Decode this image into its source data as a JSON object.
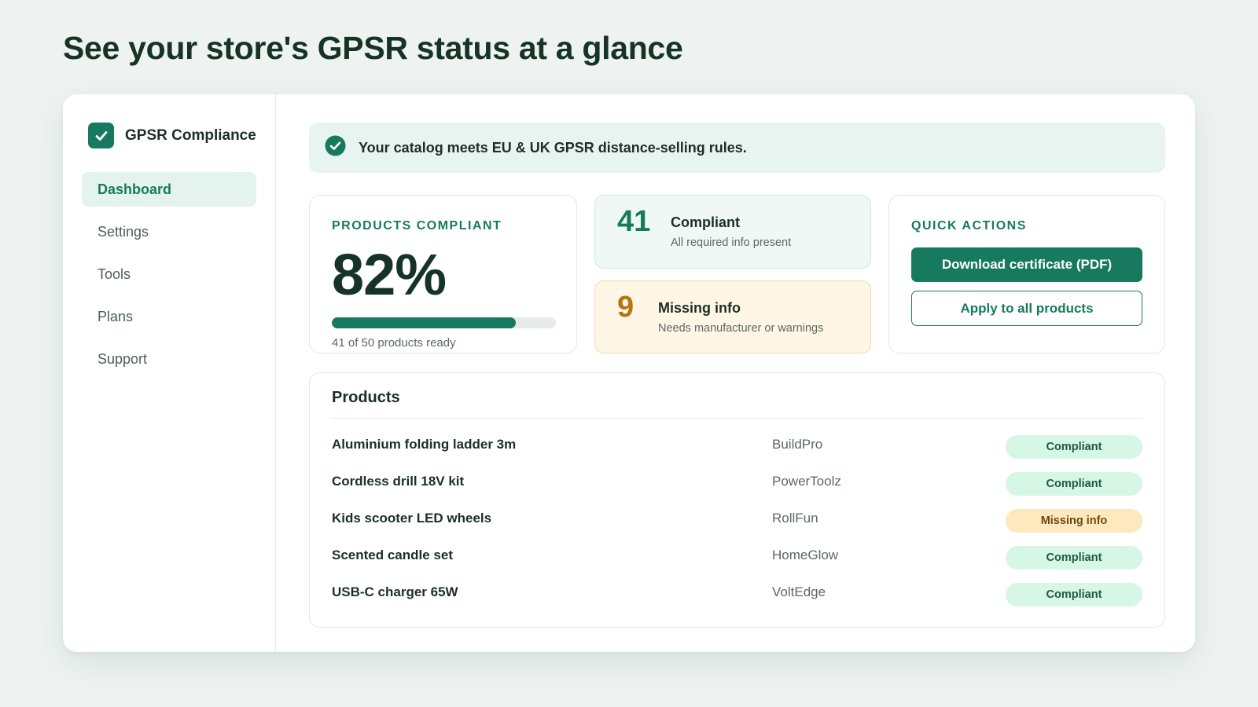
{
  "headline": "See your store's GPSR status at a glance",
  "brand": {
    "name": "GPSR Compliance",
    "icon": "check-square-icon"
  },
  "nav": [
    {
      "label": "Dashboard",
      "active": true
    },
    {
      "label": "Settings",
      "active": false
    },
    {
      "label": "Tools",
      "active": false
    },
    {
      "label": "Plans",
      "active": false
    },
    {
      "label": "Support",
      "active": false
    }
  ],
  "banner": {
    "icon": "check-circle-icon",
    "text": "Your catalog meets EU & UK GPSR distance-selling rules."
  },
  "compliance": {
    "eyebrow": "PRODUCTS COMPLIANT",
    "percent_label": "82%",
    "progress": 0.82,
    "caption": "41 of 50 products ready"
  },
  "stats": {
    "compliant": {
      "value": "41",
      "title": "Compliant",
      "sub": "All required info present"
    },
    "missing": {
      "value": "9",
      "title": "Missing info",
      "sub": "Needs manufacturer or warnings"
    }
  },
  "actions": {
    "eyebrow": "QUICK ACTIONS",
    "primary": "Download certificate (PDF)",
    "secondary": "Apply to all products"
  },
  "products": {
    "title": "Products",
    "rows": [
      {
        "name": "Aluminium folding ladder 3m",
        "brand": "BuildPro",
        "status": "Compliant",
        "kind": "ok"
      },
      {
        "name": "Cordless drill 18V kit",
        "brand": "PowerToolz",
        "status": "Compliant",
        "kind": "ok"
      },
      {
        "name": "Kids scooter LED wheels",
        "brand": "RollFun",
        "status": "Missing info",
        "kind": "warn"
      },
      {
        "name": "Scented candle set",
        "brand": "HomeGlow",
        "status": "Compliant",
        "kind": "ok"
      },
      {
        "name": "USB-C charger 65W",
        "brand": "VoltEdge",
        "status": "Compliant",
        "kind": "ok"
      }
    ]
  },
  "colors": {
    "accent": "#177a5e",
    "warning": "#b87412",
    "background": "#eef3f1"
  }
}
